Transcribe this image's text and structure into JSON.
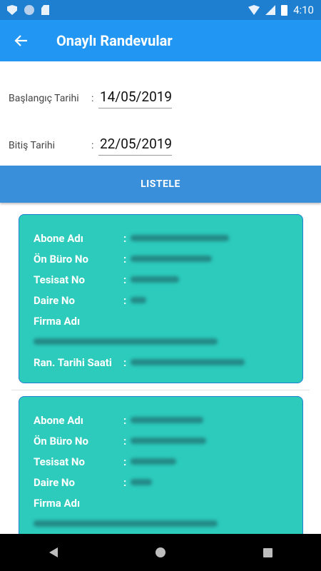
{
  "status_bar": {
    "time": "4:10"
  },
  "app_bar": {
    "title": "Onaylı Randevular"
  },
  "form": {
    "start_label": "Başlangıç Tarihi",
    "start_value": "14/05/2019",
    "end_label": "Bitiş Tarihi",
    "end_value": "22/05/2019",
    "colon": ":"
  },
  "list_button": "LISTELE",
  "cards": [
    {
      "abone_label": "Abone Adı",
      "onburo_label": "Ön Büro No",
      "tesisat_label": "Tesisat No",
      "daire_label": "Daire No",
      "firma_label": "Firma Adı",
      "tarih_label": "Ran. Tarihi Saati"
    },
    {
      "abone_label": "Abone Adı",
      "onburo_label": "Ön Büro No",
      "tesisat_label": "Tesisat No",
      "daire_label": "Daire No",
      "firma_label": "Firma Adı"
    }
  ],
  "colors": {
    "app_bar": "#2196f3",
    "status_bar": "#1e7fd0",
    "button": "#3a8fdb",
    "card": "#2ccbbc"
  },
  "icons": {
    "back": "arrow-left-icon"
  }
}
